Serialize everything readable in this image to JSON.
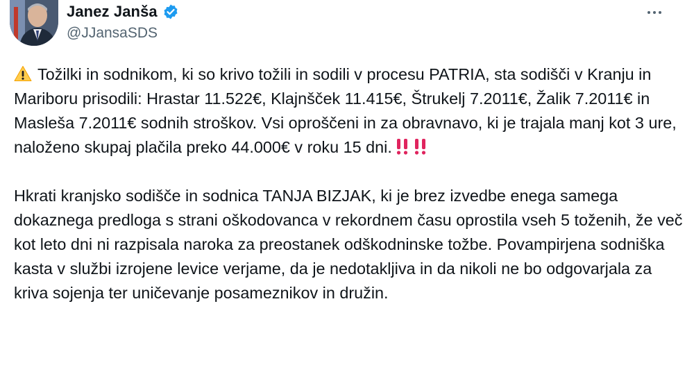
{
  "author": {
    "display_name": "Janez Janša",
    "handle": "@JJansaSDS",
    "avatar_icon": "profile-photo",
    "verified_icon": "verified-badge-icon",
    "verified_color": "#1d9bf0"
  },
  "menu": {
    "more_icon": "more-options-icon"
  },
  "tweet": {
    "warning_icon": "warning-icon",
    "paragraph1_text": "Tožilki in sodnikom, ki so krivo tožili in sodili v procesu PATRIA, sta sodišči v Kranju in Mariboru prisodili: Hrastar 11.522€, Klajnšček 11.415€, Štrukelj 7.2011€, Žalik 7.2011€ in Masleša 7.2011€ sodnih stroškov. Vsi oproščeni in za obravnavo, ki je trajala manj kot 3 ure, naloženo skupaj plačila preko 44.000€ v roku 15 dni.",
    "exclamation_icon": "double-exclamation-icon",
    "exclamation_color": "#e0245e",
    "paragraph2_text": "Hkrati kranjsko sodišče in sodnica TANJA BIZJAK, ki je brez izvedbe enega samega dokaznega predloga s strani oškodovanca v rekordnem času oprostila vseh 5 toženih, že več kot leto dni ni razpisala naroka za preostanek odškodninske tožbe. Povampirjena sodniška kasta v službi izrojene levice verjame, da je nedotakljiva in da nikoli ne bo odgovarjala za kriva sojenja ter uničevanje posameznikov in družin."
  }
}
